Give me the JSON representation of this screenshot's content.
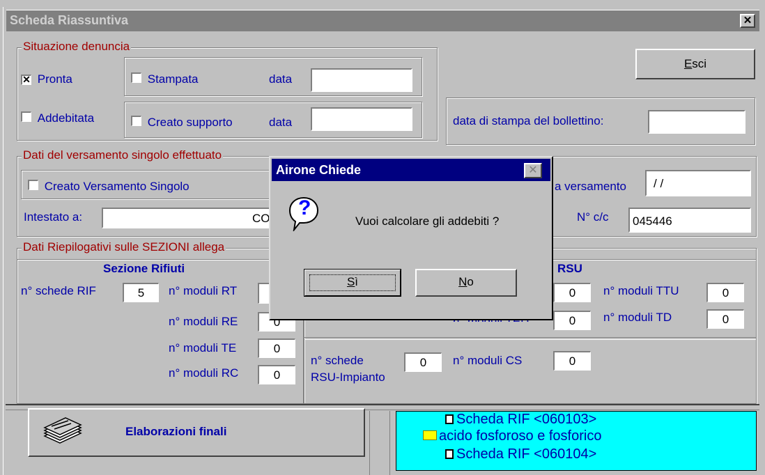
{
  "window": {
    "title": "Scheda Riassuntiva",
    "close_glyph": "✕"
  },
  "situazione": {
    "legend": "Situazione denuncia",
    "pronta": {
      "label": "Pronta",
      "checked": "✕"
    },
    "addebitata": {
      "label": "Addebitata"
    },
    "stampata": {
      "label": "Stampata",
      "data_label": "data"
    },
    "supporto": {
      "label": "Creato supporto",
      "data_label": "data"
    }
  },
  "esci": {
    "mn": "E",
    "rest": "sci"
  },
  "bollettino_label": "data di stampa del bollettino:",
  "versamento": {
    "legend": "Dati del versamento singolo effettuato",
    "creato_label": "Creato Versamento Singolo",
    "intestato_label": "Intestato a:",
    "intestato_value": "CO",
    "data_label": "a versamento",
    "data_value": "/ /",
    "cc_label": "N° c/c",
    "cc_value": "045446"
  },
  "sezioni": {
    "legend": "Dati Riepilogativi sulle SEZIONI allega",
    "rifiuti_title": "Sezione Rifiuti",
    "rsu_title": "RSU",
    "schede_rif_label": "n° schede RIF",
    "schede_rif_value": "5",
    "rt_label": "n° moduli RT",
    "re_label": "n° moduli RE",
    "re_value": "0",
    "te_label": "n° moduli TE",
    "te_value": "0",
    "rc_label": "n° moduli RC",
    "rc_value": "0",
    "rsu_a_value": "0",
    "teu_label": "n° moduli TEU",
    "teu_value": "0",
    "ttu_label": "n° moduli TTU",
    "ttu_value": "0",
    "td_label": "n° moduli TD",
    "td_value": "0",
    "schede_rsu_label1": "n° schede",
    "schede_rsu_label2": "RSU-Impianto",
    "schede_rsu_value": "0",
    "cs_label": "n° moduli CS",
    "cs_value": "0"
  },
  "elaborazioni": {
    "label": "Elaborazioni finali"
  },
  "tree": {
    "items": [
      "Scheda RIF  <060103>",
      "acido fosforoso e fosforico",
      "Scheda RIF  <060104>"
    ]
  },
  "dialog": {
    "title": "Airone Chiede",
    "icon_glyph": "?",
    "message": "Vuoi calcolare gli addebiti ?",
    "si_mn": "S",
    "si_rest": "ì",
    "no_mn": "N",
    "no_rest": "o"
  },
  "colors": {
    "titlebar_inactive": "#808080",
    "dialog_title": "#000080",
    "tree_bg": "#00ffff"
  }
}
